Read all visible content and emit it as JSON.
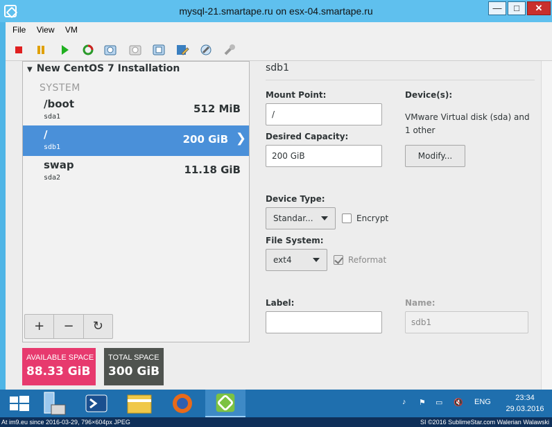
{
  "window": {
    "title": "mysql-21.smartape.ru on esx-04.smartape.ru",
    "min_glyph": "—",
    "max_glyph": "□",
    "close_glyph": "✕"
  },
  "menu": [
    "File",
    "View",
    "VM"
  ],
  "toolbar_icons": [
    "power-off-icon",
    "suspend-icon",
    "power-on-icon",
    "reset-icon",
    "snapshot-icon",
    "revert-snapshot-icon",
    "snapshot-manager-icon",
    "edit-settings-icon",
    "vm-tools-icon",
    "install-tools-icon"
  ],
  "installer": {
    "tree_title": "New CentOS 7 Installation",
    "group_label": "SYSTEM",
    "mount_points": [
      {
        "name": "/boot",
        "device": "sda1",
        "size": "512 MiB",
        "selected": false
      },
      {
        "name": "/",
        "device": "sdb1",
        "size": "200 GiB",
        "selected": true
      },
      {
        "name": "swap",
        "device": "sda2",
        "size": "11.18 GiB",
        "selected": false
      }
    ],
    "add_label": "+",
    "remove_label": "−",
    "refresh_label": "↻",
    "available_label": "AVAILABLE SPACE",
    "available_value": "88.33 GiB",
    "total_label": "TOTAL SPACE",
    "total_value": "300 GiB",
    "available_color": "#e73a6e",
    "total_color": "#4f534f"
  },
  "details": {
    "partition_title": "sdb1",
    "mount_point_label": "Mount Point:",
    "mount_point_value": "/",
    "desired_capacity_label": "Desired Capacity:",
    "desired_capacity_value": "200 GiB",
    "devices_label": "Device(s):",
    "devices_text": "VMware Virtual disk (sda) and 1 other",
    "modify_label": "Modify...",
    "device_type_label": "Device Type:",
    "device_type_value": "Standar...",
    "encrypt_label": "Encrypt",
    "encrypt_checked": false,
    "file_system_label": "File System:",
    "file_system_value": "ext4",
    "reformat_label": "Reformat",
    "reformat_checked": true,
    "label_label": "Label:",
    "label_value": "",
    "name_label": "Name:",
    "name_value": "sdb1"
  },
  "taskbar": {
    "apps": [
      "start-icon",
      "server-manager-icon",
      "powershell-icon",
      "file-explorer-icon",
      "firefox-icon",
      "vsphere-client-icon"
    ],
    "language": "ENG",
    "time": "23:34",
    "date": "29.03.2016"
  },
  "watermark": {
    "left": "At im9.eu since 2016-03-29, 796×604px JPEG",
    "right": "SI ©2016 SublimeStar.com Walerian Walawski"
  }
}
